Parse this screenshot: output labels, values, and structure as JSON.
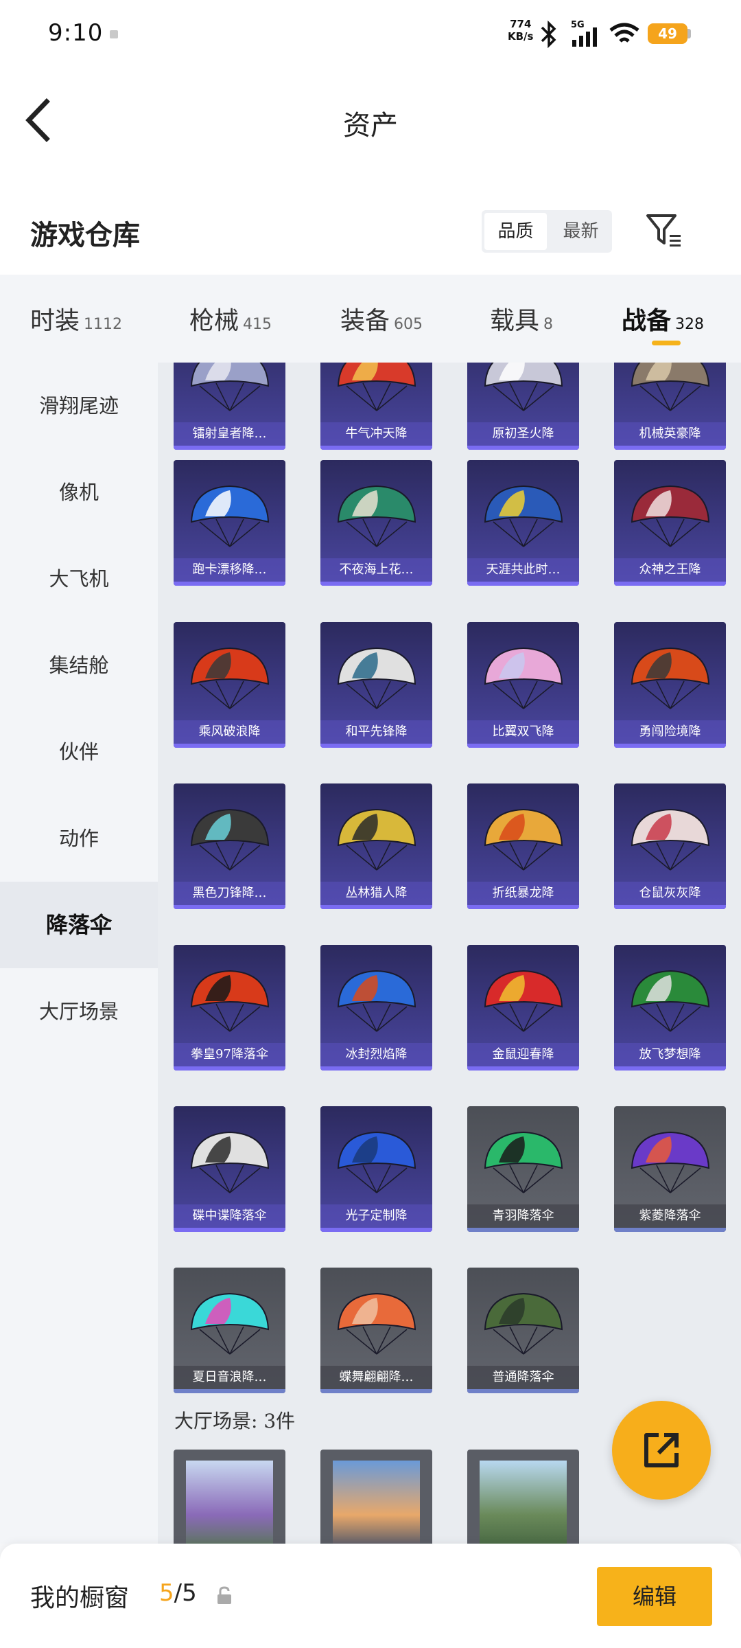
{
  "status_bar": {
    "time": "9:10",
    "net_speed": "774",
    "net_unit": "KB/s",
    "network": "5G",
    "battery": "49"
  },
  "header": {
    "title": "资产"
  },
  "section": {
    "title": "游戏仓库",
    "sort_options": [
      "品质",
      "最新"
    ],
    "sort_selected": "品质"
  },
  "tabs": [
    {
      "label": "时装",
      "count": "1112"
    },
    {
      "label": "枪械",
      "count": "415"
    },
    {
      "label": "装备",
      "count": "605"
    },
    {
      "label": "载具",
      "count": "8"
    },
    {
      "label": "战备",
      "count": "328",
      "active": true
    }
  ],
  "sidebar": {
    "items": [
      "滑翔尾迹",
      "像机",
      "大飞机",
      "集结舱",
      "伙伴",
      "动作",
      "降落伞",
      "大厅场景"
    ],
    "active": "降落伞"
  },
  "grid": {
    "items": [
      "镭射皇者降…",
      "牛气冲天降",
      "原初圣火降",
      "机械英豪降",
      "跑卡漂移降…",
      "不夜海上花…",
      "天涯共此时…",
      "众神之王降",
      "乘风破浪降",
      "和平先锋降",
      "比翼双飞降",
      "勇闯险境降",
      "黑色刀锋降…",
      "丛林猎人降",
      "折纸暴龙降",
      "仓鼠灰灰降",
      "拳皇97降落伞",
      "冰封烈焰降",
      "金鼠迎春降",
      "放飞梦想降",
      "碟中谍降落伞",
      "光子定制降",
      "青羽降落伞",
      "紫菱降落伞",
      "夏日音浪降…",
      "蝶舞翩翩降…",
      "普通降落伞"
    ]
  },
  "scenes": {
    "heading": "大厅场景: 3件"
  },
  "bottom_bar": {
    "label": "我的橱窗",
    "current": "5",
    "total": "/5",
    "edit_label": "编辑"
  },
  "colors": {
    "accent": "#f7b21a",
    "card_purple": "#3d3a84",
    "card_grey": "#5a5d65"
  }
}
